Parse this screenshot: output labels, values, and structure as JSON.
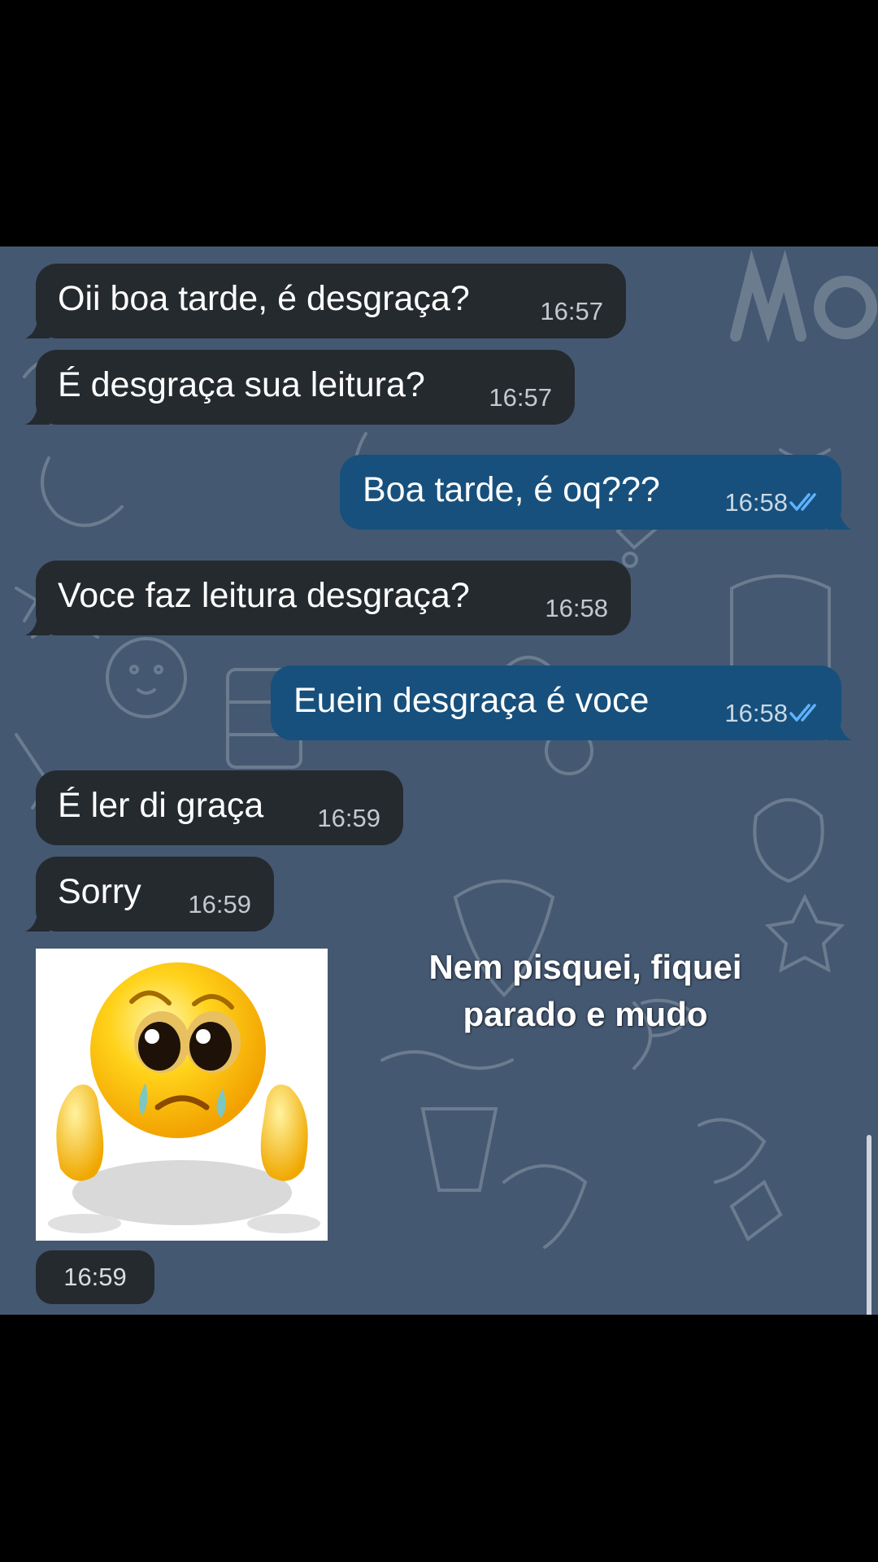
{
  "chat": {
    "messages": [
      {
        "side": "in",
        "text": "Oii boa tarde, é desgraça?",
        "time": "16:57"
      },
      {
        "side": "in",
        "text": "É desgraça sua leitura?",
        "time": "16:57"
      },
      {
        "side": "out",
        "text": "Boa tarde, é oq???",
        "time": "16:58",
        "status": "read"
      },
      {
        "side": "in",
        "text": "Voce faz leitura desgraça?",
        "time": "16:58"
      },
      {
        "side": "out",
        "text": "Euein desgraça é voce",
        "time": "16:58",
        "status": "read"
      },
      {
        "side": "in",
        "text": "É ler di graça",
        "time": "16:59"
      },
      {
        "side": "in",
        "text": "Sorry",
        "time": "16:59"
      }
    ],
    "sticker": {
      "icon": "crying-emoji-sticker",
      "time": "16:59"
    }
  },
  "overlay": {
    "line1": "Nem pisquei, fiquei",
    "line2": "parado e mudo"
  },
  "colors": {
    "background": "#445872",
    "incoming_bubble": "#252a2f",
    "outgoing_bubble": "#17507c",
    "read_check": "#5fb2ff"
  }
}
